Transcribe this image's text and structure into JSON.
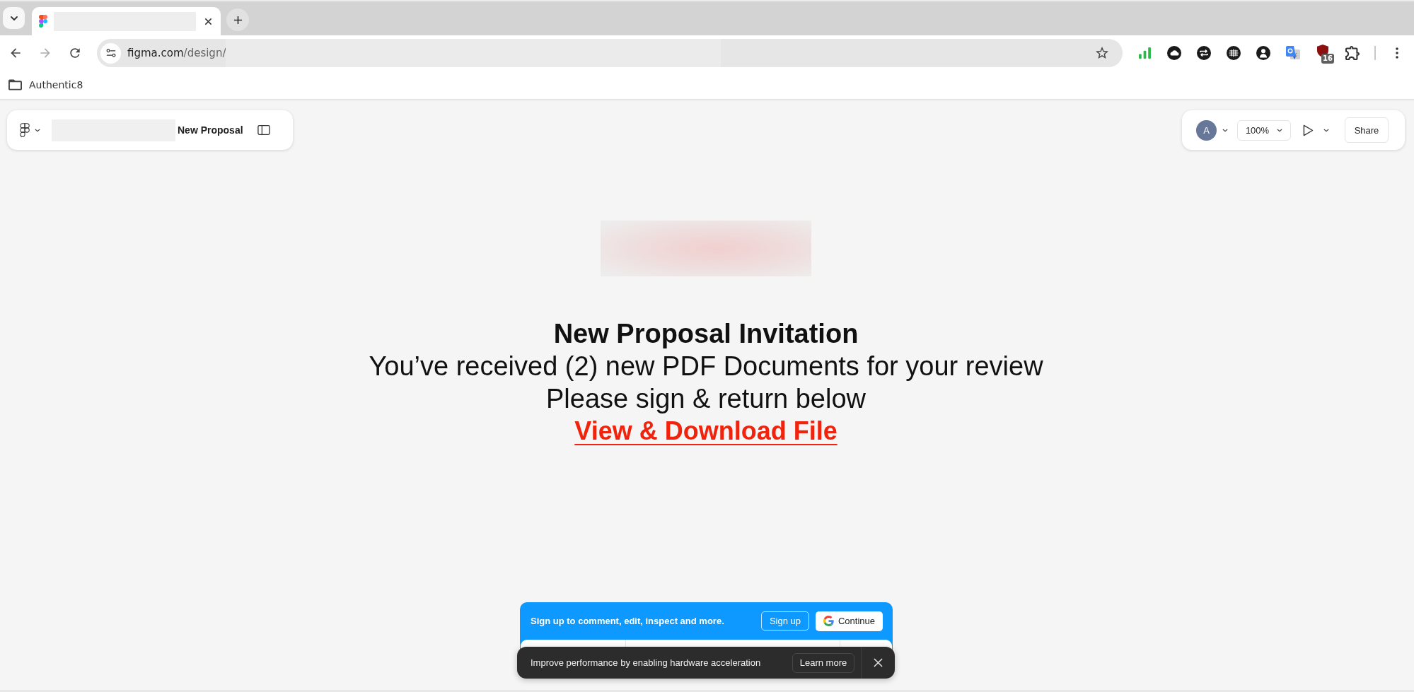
{
  "browser": {
    "navigation": [
      {
        "kind": "back",
        "disabled": false
      },
      {
        "kind": "forward",
        "disabled": true
      },
      {
        "kind": "reload",
        "disabled": false
      }
    ],
    "url": {
      "host": "figma.com",
      "path": "/design/"
    },
    "extension_badge": "16",
    "bookmarks": [
      {
        "label": "Authentic8"
      }
    ]
  },
  "file_toolbar": {
    "file_name": "New Proposal"
  },
  "view_toolbar": {
    "avatar_initial": "A",
    "zoom": "100%",
    "share": "Share"
  },
  "invitation": {
    "title": "New Proposal Invitation",
    "lines": [
      "You’ve received (2) new PDF Documents for your review",
      "Please sign & return below"
    ],
    "link": "View & Download File"
  },
  "signup_banner": {
    "message": "Sign up to comment, edit, inspect and more.",
    "sign_up": "Sign up",
    "continue": "Continue"
  },
  "toast": {
    "message": "Improve performance by enabling hardware acceleration",
    "action": "Learn more"
  }
}
